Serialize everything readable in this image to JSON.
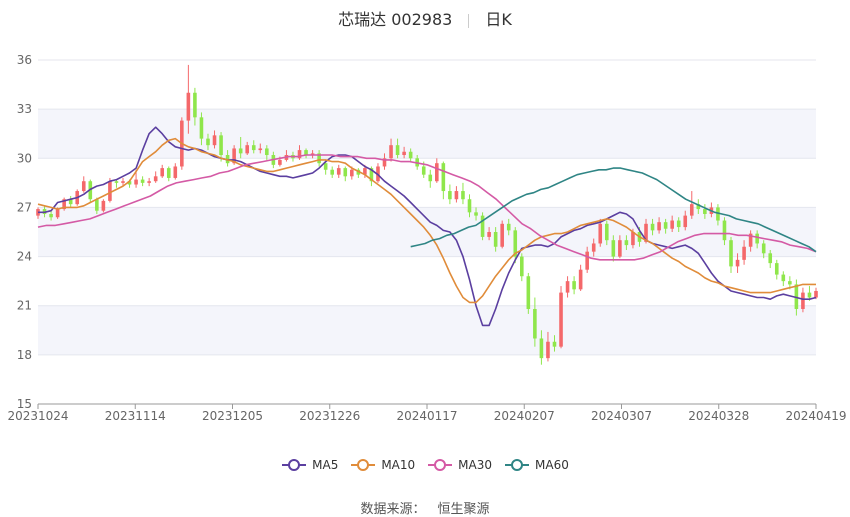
{
  "header": {
    "stock": "芯瑞达 002983",
    "period": "日K"
  },
  "source": {
    "label": "数据来源：",
    "value": "恒生聚源"
  },
  "colors": {
    "up": "#f4686a",
    "down": "#8fe64b",
    "MA5": "#5b3fa0",
    "MA10": "#e08c3a",
    "MA30": "#d45aa5",
    "MA60": "#2f8585",
    "band": "#f4f5fb"
  },
  "chart_data": {
    "type": "candlestick",
    "title": "芯瑞达 002983 日K",
    "ylim": [
      15,
      36
    ],
    "yticks": [
      15,
      18,
      21,
      24,
      27,
      30,
      33,
      36
    ],
    "xticks": [
      "20231024",
      "20231114",
      "20231205",
      "20231226",
      "20240117",
      "20240207",
      "20240307",
      "20240328",
      "20240419"
    ],
    "grid": true,
    "legend_position": "bottom",
    "n_days": 120,
    "candles": [
      [
        26.5,
        26.9,
        26.3,
        27.0
      ],
      [
        26.9,
        26.6,
        26.4,
        27.1
      ],
      [
        26.6,
        26.4,
        26.2,
        26.8
      ],
      [
        26.4,
        26.9,
        26.3,
        27.0
      ],
      [
        26.9,
        27.5,
        26.8,
        27.6
      ],
      [
        27.5,
        27.2,
        27.0,
        27.7
      ],
      [
        27.2,
        28.0,
        27.1,
        28.1
      ],
      [
        28.0,
        28.6,
        27.9,
        28.9
      ],
      [
        28.6,
        27.5,
        27.3,
        28.7
      ],
      [
        27.5,
        26.8,
        26.6,
        27.6
      ],
      [
        26.8,
        27.4,
        26.7,
        27.5
      ],
      [
        27.4,
        28.6,
        27.3,
        28.8
      ],
      [
        28.6,
        28.5,
        28.2,
        28.7
      ],
      [
        28.5,
        28.6,
        28.3,
        28.8
      ],
      [
        28.6,
        28.4,
        28.2,
        28.7
      ],
      [
        28.4,
        28.7,
        28.2,
        29.3
      ],
      [
        28.7,
        28.5,
        28.3,
        28.9
      ],
      [
        28.5,
        28.6,
        28.3,
        28.8
      ],
      [
        28.6,
        28.9,
        28.5,
        29.2
      ],
      [
        28.9,
        29.4,
        28.8,
        29.6
      ],
      [
        29.4,
        28.8,
        28.6,
        29.5
      ],
      [
        28.8,
        29.5,
        28.7,
        29.7
      ],
      [
        29.5,
        32.3,
        29.3,
        32.5
      ],
      [
        32.3,
        34.0,
        31.5,
        35.7
      ],
      [
        34.0,
        32.5,
        32.0,
        34.3
      ],
      [
        32.5,
        31.2,
        30.8,
        32.8
      ],
      [
        31.2,
        30.8,
        30.5,
        31.5
      ],
      [
        30.8,
        31.4,
        30.6,
        31.7
      ],
      [
        31.4,
        30.2,
        29.8,
        31.6
      ],
      [
        30.2,
        29.7,
        29.5,
        30.5
      ],
      [
        29.7,
        30.6,
        29.6,
        30.8
      ],
      [
        30.6,
        30.3,
        30.0,
        31.3
      ],
      [
        30.3,
        30.8,
        30.2,
        31.0
      ],
      [
        30.8,
        30.5,
        30.3,
        31.1
      ],
      [
        30.5,
        30.6,
        30.3,
        30.9
      ],
      [
        30.6,
        30.2,
        29.9,
        30.8
      ],
      [
        30.2,
        29.6,
        29.4,
        30.4
      ],
      [
        29.6,
        29.9,
        29.5,
        30.1
      ],
      [
        29.9,
        30.2,
        29.8,
        30.5
      ],
      [
        30.2,
        30.0,
        29.8,
        30.4
      ],
      [
        30.0,
        30.5,
        29.9,
        30.8
      ],
      [
        30.5,
        30.2,
        30.0,
        30.6
      ],
      [
        30.2,
        30.3,
        30.0,
        30.5
      ],
      [
        30.3,
        29.7,
        29.5,
        30.5
      ],
      [
        29.7,
        29.3,
        29.0,
        29.9
      ],
      [
        29.3,
        29.0,
        28.8,
        29.5
      ],
      [
        29.0,
        29.4,
        28.8,
        29.6
      ],
      [
        29.4,
        28.9,
        28.6,
        29.5
      ],
      [
        28.9,
        29.3,
        28.7,
        29.5
      ],
      [
        29.3,
        29.0,
        28.8,
        29.4
      ],
      [
        29.0,
        29.4,
        28.8,
        29.6
      ],
      [
        29.4,
        28.6,
        28.3,
        29.5
      ],
      [
        28.6,
        29.5,
        28.5,
        29.7
      ],
      [
        29.5,
        30.0,
        29.3,
        30.3
      ],
      [
        30.0,
        30.8,
        29.8,
        31.2
      ],
      [
        30.8,
        30.2,
        30.0,
        31.2
      ],
      [
        30.2,
        30.4,
        30.0,
        30.7
      ],
      [
        30.4,
        30.0,
        29.8,
        30.6
      ],
      [
        30.0,
        29.5,
        29.3,
        30.2
      ],
      [
        29.5,
        29.0,
        28.8,
        29.8
      ],
      [
        29.0,
        28.6,
        28.2,
        29.3
      ],
      [
        28.6,
        29.7,
        28.5,
        30.0
      ],
      [
        29.7,
        28.0,
        27.5,
        29.8
      ],
      [
        28.0,
        27.5,
        27.2,
        28.4
      ],
      [
        27.5,
        28.0,
        27.3,
        28.3
      ],
      [
        28.0,
        27.5,
        27.2,
        28.5
      ],
      [
        27.5,
        26.7,
        26.4,
        27.8
      ],
      [
        26.7,
        26.5,
        26.2,
        27.0
      ],
      [
        26.5,
        25.2,
        25.0,
        26.7
      ],
      [
        25.2,
        25.5,
        25.0,
        25.8
      ],
      [
        25.5,
        24.6,
        24.3,
        25.8
      ],
      [
        24.6,
        26.0,
        24.5,
        26.2
      ],
      [
        26.0,
        25.6,
        25.3,
        26.3
      ],
      [
        25.6,
        24.0,
        23.6,
        25.8
      ],
      [
        24.0,
        22.8,
        22.5,
        24.2
      ],
      [
        22.8,
        20.8,
        20.5,
        23.0
      ],
      [
        20.8,
        19.0,
        18.5,
        21.5
      ],
      [
        19.0,
        17.8,
        17.4,
        19.5
      ],
      [
        17.8,
        18.8,
        17.6,
        19.4
      ],
      [
        18.8,
        18.5,
        18.2,
        19.2
      ],
      [
        18.5,
        21.8,
        18.4,
        22.2
      ],
      [
        21.8,
        22.5,
        21.5,
        22.8
      ],
      [
        22.5,
        22.0,
        21.7,
        22.8
      ],
      [
        22.0,
        23.2,
        21.9,
        23.5
      ],
      [
        23.2,
        24.3,
        23.0,
        24.6
      ],
      [
        24.3,
        24.8,
        24.0,
        25.1
      ],
      [
        24.8,
        26.0,
        24.6,
        26.3
      ],
      [
        26.0,
        25.0,
        24.7,
        26.2
      ],
      [
        25.0,
        24.0,
        23.7,
        25.3
      ],
      [
        24.0,
        25.0,
        23.9,
        25.3
      ],
      [
        25.0,
        24.7,
        24.4,
        25.3
      ],
      [
        24.7,
        25.5,
        24.5,
        25.7
      ],
      [
        25.5,
        24.9,
        24.6,
        25.8
      ],
      [
        24.9,
        26.0,
        24.8,
        26.3
      ],
      [
        26.0,
        25.6,
        25.3,
        26.3
      ],
      [
        25.6,
        26.1,
        25.4,
        26.4
      ],
      [
        26.1,
        25.7,
        25.4,
        26.3
      ],
      [
        25.7,
        26.2,
        25.5,
        26.5
      ],
      [
        26.2,
        25.8,
        25.5,
        26.4
      ],
      [
        25.8,
        26.5,
        25.6,
        26.8
      ],
      [
        26.5,
        27.2,
        26.3,
        28.0
      ],
      [
        27.2,
        26.9,
        26.6,
        27.5
      ],
      [
        26.9,
        26.6,
        26.3,
        27.2
      ],
      [
        26.6,
        27.0,
        26.4,
        27.3
      ],
      [
        27.0,
        26.2,
        25.9,
        27.2
      ],
      [
        26.2,
        25.0,
        24.7,
        26.4
      ],
      [
        25.0,
        23.4,
        23.0,
        25.2
      ],
      [
        23.4,
        23.8,
        23.0,
        24.2
      ],
      [
        23.8,
        24.6,
        23.5,
        25.0
      ],
      [
        24.6,
        25.4,
        24.3,
        25.6
      ],
      [
        25.4,
        24.8,
        24.5,
        25.6
      ],
      [
        24.8,
        24.2,
        23.9,
        25.0
      ],
      [
        24.2,
        23.6,
        23.3,
        24.4
      ],
      [
        23.6,
        22.9,
        22.6,
        23.8
      ],
      [
        22.9,
        22.5,
        22.2,
        23.1
      ],
      [
        22.5,
        22.3,
        22.0,
        22.8
      ],
      [
        22.3,
        20.8,
        20.4,
        22.6
      ],
      [
        20.8,
        21.8,
        20.6,
        22.1
      ],
      [
        21.8,
        21.5,
        21.3,
        22.2
      ],
      [
        21.5,
        21.9,
        21.4,
        22.1
      ]
    ],
    "series": [
      {
        "name": "MA5",
        "values": [
          26.7,
          26.7,
          26.8,
          27.3,
          27.4,
          27.5,
          27.6,
          27.8,
          28.1,
          28.3,
          28.4,
          28.6,
          28.7,
          28.9,
          29.1,
          29.4,
          30.5,
          31.5,
          31.9,
          31.5,
          31.0,
          30.7,
          30.6,
          30.5,
          30.6,
          30.5,
          30.3,
          30.1,
          30.0,
          29.9,
          29.9,
          29.8,
          29.6,
          29.4,
          29.2,
          29.1,
          29.0,
          28.9,
          28.9,
          28.8,
          28.9,
          29.0,
          29.1,
          29.4,
          29.8,
          30.1,
          30.2,
          30.2,
          30.1,
          29.8,
          29.5,
          29.3,
          29.0,
          28.6,
          28.3,
          28.0,
          27.7,
          27.3,
          26.9,
          26.5,
          26.1,
          25.9,
          25.6,
          25.5,
          25.0,
          24.0,
          22.6,
          21.0,
          19.8,
          19.8,
          20.8,
          22.0,
          23.0,
          23.8,
          24.5,
          24.6,
          24.7,
          24.7,
          24.6,
          24.8,
          25.2,
          25.4,
          25.6,
          25.7,
          25.9,
          26.0,
          26.1,
          26.3,
          26.5,
          26.7,
          26.6,
          26.3,
          25.6,
          25.0,
          24.8,
          24.7,
          24.6,
          24.5,
          24.6,
          24.7,
          24.5,
          24.2,
          23.6,
          23.0,
          22.5,
          22.2,
          21.9,
          21.8,
          21.7,
          21.6,
          21.5,
          21.5,
          21.4,
          21.6,
          21.7,
          21.6,
          21.5,
          21.4,
          21.4,
          21.5
        ]
      },
      {
        "name": "MA10",
        "values": [
          27.2,
          27.1,
          27.0,
          26.9,
          27.0,
          27.0,
          27.0,
          27.1,
          27.3,
          27.5,
          27.7,
          27.9,
          28.1,
          28.3,
          28.6,
          29.2,
          29.8,
          30.1,
          30.4,
          30.8,
          31.1,
          31.2,
          30.9,
          30.7,
          30.6,
          30.4,
          30.3,
          30.2,
          30.0,
          29.9,
          29.8,
          29.6,
          29.5,
          29.4,
          29.3,
          29.2,
          29.2,
          29.3,
          29.4,
          29.5,
          29.6,
          29.7,
          29.8,
          29.9,
          29.9,
          29.8,
          29.8,
          29.7,
          29.4,
          29.2,
          29.0,
          28.7,
          28.4,
          28.1,
          27.8,
          27.4,
          27.0,
          26.6,
          26.2,
          25.8,
          25.3,
          24.7,
          23.9,
          23.0,
          22.2,
          21.5,
          21.2,
          21.2,
          21.6,
          22.2,
          22.8,
          23.3,
          23.8,
          24.2,
          24.4,
          24.7,
          25.0,
          25.2,
          25.3,
          25.4,
          25.4,
          25.5,
          25.7,
          25.9,
          26.0,
          26.1,
          26.2,
          26.3,
          26.2,
          26.0,
          25.8,
          25.5,
          25.2,
          25.0,
          24.8,
          24.5,
          24.2,
          23.9,
          23.7,
          23.4,
          23.2,
          23.0,
          22.7,
          22.5,
          22.4,
          22.2,
          22.1,
          22.0,
          21.9,
          21.8,
          21.8,
          21.8,
          21.8,
          21.9,
          22.0,
          22.1,
          22.2,
          22.3,
          22.3,
          22.3
        ]
      },
      {
        "name": "MA30",
        "values": [
          25.8,
          25.9,
          25.9,
          26.0,
          26.1,
          26.2,
          26.3,
          26.5,
          26.7,
          26.9,
          27.1,
          27.3,
          27.5,
          27.7,
          28.0,
          28.3,
          28.5,
          28.6,
          28.7,
          28.8,
          28.9,
          29.1,
          29.2,
          29.4,
          29.6,
          29.7,
          29.8,
          29.9,
          30.0,
          30.1,
          30.1,
          30.2,
          30.2,
          30.2,
          30.2,
          30.1,
          30.1,
          30.1,
          30.0,
          30.0,
          29.9,
          29.9,
          29.8,
          29.8,
          29.7,
          29.6,
          29.4,
          29.2,
          29.0,
          28.8,
          28.6,
          28.3,
          27.9,
          27.5,
          27.0,
          26.5,
          26.0,
          25.7,
          25.3,
          25.0,
          24.7,
          24.5,
          24.3,
          24.1,
          23.9,
          23.8,
          23.8,
          23.8,
          23.8,
          23.8,
          23.9,
          24.1,
          24.3,
          24.6,
          24.9,
          25.1,
          25.3,
          25.4,
          25.4,
          25.4,
          25.4,
          25.3,
          25.3,
          25.2,
          25.1,
          25.0,
          24.9,
          24.7,
          24.6,
          24.5,
          24.3
        ]
      },
      {
        "name": "MA60",
        "values": [
          24.6,
          24.7,
          24.8,
          25.0,
          25.1,
          25.3,
          25.4,
          25.6,
          25.8,
          25.9,
          26.2,
          26.5,
          26.8,
          27.1,
          27.4,
          27.6,
          27.8,
          27.9,
          28.1,
          28.2,
          28.4,
          28.6,
          28.8,
          29.0,
          29.1,
          29.2,
          29.3,
          29.3,
          29.4,
          29.4,
          29.3,
          29.2,
          29.1,
          28.9,
          28.7,
          28.4,
          28.1,
          27.8,
          27.5,
          27.3,
          27.1,
          26.9,
          26.7,
          26.6,
          26.5,
          26.3,
          26.2,
          26.1,
          26.0,
          25.8,
          25.6,
          25.4,
          25.2,
          25.0,
          24.8,
          24.6,
          24.3
        ]
      }
    ],
    "series_start": {
      "MA5": 0,
      "MA10": 0,
      "MA30": 0,
      "MA60": 57
    }
  }
}
